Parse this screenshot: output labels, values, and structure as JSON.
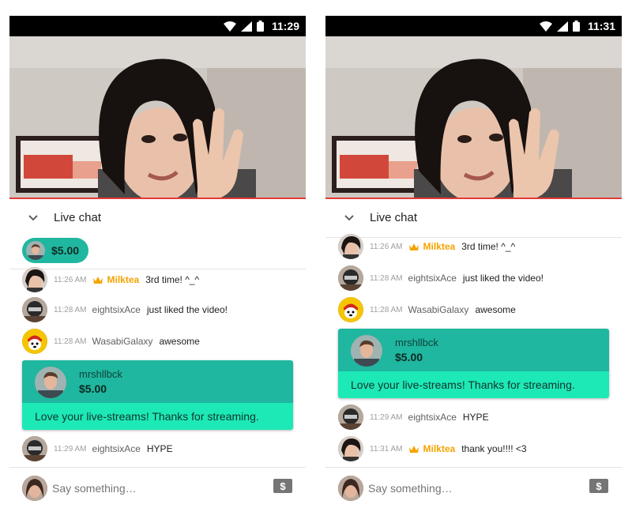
{
  "colors": {
    "accent_green": "#1fb79f",
    "accent_light_green": "#1de9b6",
    "owner_gold": "#f5a300",
    "video_divider": "#e53935"
  },
  "left": {
    "status": {
      "time": "11:29",
      "icons": [
        "wifi-icon",
        "signal-icon",
        "battery-icon"
      ]
    },
    "chat_title": "Live chat",
    "collapse_icon": "chevron-down-icon",
    "ticker": {
      "amount": "$5.00"
    },
    "messages": [
      {
        "time": "11:26 AM",
        "author": "Milktea",
        "owner": true,
        "text": "3rd time! ^_^"
      },
      {
        "time": "11:28 AM",
        "author": "eightsixAce",
        "owner": false,
        "text": "just liked the video!"
      },
      {
        "time": "11:28 AM",
        "author": "WasabiGalaxy",
        "owner": false,
        "text": "awesome"
      }
    ],
    "superchat": {
      "name": "mrshllbck",
      "amount": "$5.00",
      "text": "Love your live-streams! Thanks for streaming."
    },
    "after": [
      {
        "time": "11:29 AM",
        "author": "eightsixAce",
        "owner": false,
        "text": "HYPE"
      }
    ],
    "input": {
      "placeholder": "Say something…",
      "money_icon": "dollar-icon"
    }
  },
  "right": {
    "status": {
      "time": "11:31",
      "icons": [
        "wifi-icon",
        "signal-icon",
        "battery-icon"
      ]
    },
    "chat_title": "Live chat",
    "collapse_icon": "chevron-down-icon",
    "messages": [
      {
        "time": "11:26 AM",
        "author": "Milktea",
        "owner": true,
        "text": "3rd time! ^_^"
      },
      {
        "time": "11:28 AM",
        "author": "eightsixAce",
        "owner": false,
        "text": "just liked the video!"
      },
      {
        "time": "11:28 AM",
        "author": "WasabiGalaxy",
        "owner": false,
        "text": "awesome"
      }
    ],
    "superchat": {
      "name": "mrshllbck",
      "amount": "$5.00",
      "text": "Love your live-streams! Thanks for streaming."
    },
    "after": [
      {
        "time": "11:29 AM",
        "author": "eightsixAce",
        "owner": false,
        "text": "HYPE"
      },
      {
        "time": "11:31 AM",
        "author": "Milktea",
        "owner": true,
        "text": "thank you!!!! <3"
      }
    ],
    "input": {
      "placeholder": "Say something…",
      "money_icon": "dollar-icon"
    }
  }
}
